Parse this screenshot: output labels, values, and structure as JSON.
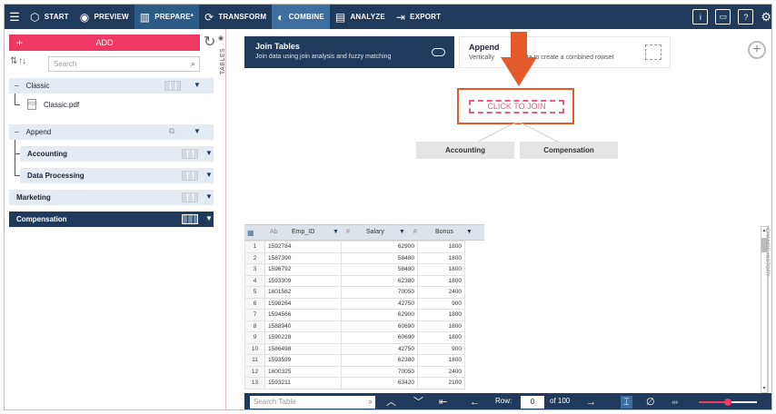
{
  "topbar": {
    "items": [
      {
        "label": "START",
        "icon": "cube-icon"
      },
      {
        "label": "PREVIEW",
        "icon": "eye-icon"
      },
      {
        "label": "PREPARE*",
        "icon": "table-icon"
      },
      {
        "label": "TRANSFORM",
        "icon": "transform-icon"
      },
      {
        "label": "COMBINE",
        "icon": "combine-icon"
      },
      {
        "label": "ANALYZE",
        "icon": "analyze-icon"
      },
      {
        "label": "EXPORT",
        "icon": "export-icon"
      }
    ]
  },
  "left": {
    "add_label": "ADD",
    "search_placeholder": "Search",
    "tables_tab": "TABLES",
    "groups": [
      {
        "label": "Classic"
      },
      {
        "label": "Append"
      }
    ],
    "file": "Classic.pdf",
    "tables": [
      {
        "label": "Accounting"
      },
      {
        "label": "Data Processing"
      },
      {
        "label": "Marketing"
      },
      {
        "label": "Compensation"
      }
    ]
  },
  "join_card": {
    "title": "Join Tables",
    "subtitle": "Join data using join analysis and fuzzy matching"
  },
  "append_card": {
    "title": "Append",
    "subtitle_left": "Vertically",
    "subtitle_right": "data to create a combined rowset"
  },
  "canvas": {
    "click_to_join": "CLICK TO JOIN",
    "left_table": "Accounting",
    "right_table": "Compensation"
  },
  "grid": {
    "columns": [
      {
        "type": "Ab",
        "name": "Emp_ID"
      },
      {
        "type": "#",
        "name": "Salary"
      },
      {
        "type": "#",
        "name": "Bonus"
      }
    ],
    "rows": [
      [
        "1",
        "1592784",
        "62900",
        "1800"
      ],
      [
        "2",
        "1587390",
        "58480",
        "1800"
      ],
      [
        "3",
        "1596792",
        "58480",
        "1800"
      ],
      [
        "4",
        "1593309",
        "62380",
        "1800"
      ],
      [
        "5",
        "1601562",
        "70050",
        "2400"
      ],
      [
        "6",
        "1598264",
        "42750",
        "900"
      ],
      [
        "7",
        "1594566",
        "62900",
        "1800"
      ],
      [
        "8",
        "1588940",
        "60690",
        "1800"
      ],
      [
        "9",
        "1590228",
        "60690",
        "1800"
      ],
      [
        "10",
        "1586498",
        "42750",
        "900"
      ],
      [
        "11",
        "1593599",
        "62380",
        "1800"
      ],
      [
        "12",
        "1600325",
        "70050",
        "2400"
      ],
      [
        "13",
        "1593211",
        "63420",
        "2100"
      ]
    ],
    "side_label": "CHANGE HISTORY"
  },
  "bottombar": {
    "search_placeholder": "Search Table",
    "row_label": "Row:",
    "row_value": "0",
    "of_label": "of 100",
    "zoom_level": 0.5
  },
  "colors": {
    "navy": "#1f3a5a",
    "pink": "#ee3a63",
    "orange": "#e55a2b"
  }
}
